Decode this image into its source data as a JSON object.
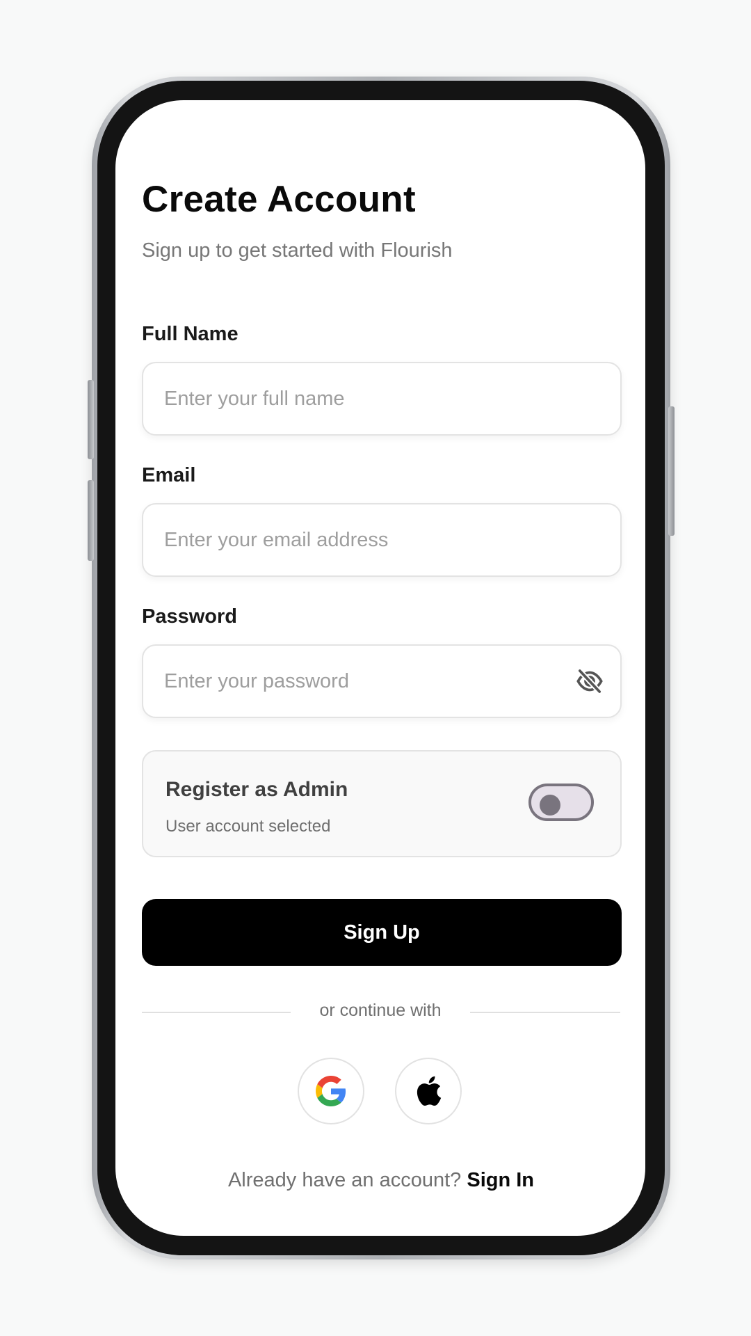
{
  "header": {
    "title": "Create Account",
    "subtitle": "Sign up to get started with Flourish"
  },
  "form": {
    "full_name": {
      "label": "Full Name",
      "placeholder": "Enter your full name",
      "value": ""
    },
    "email": {
      "label": "Email",
      "placeholder": "Enter your email address",
      "value": ""
    },
    "password": {
      "label": "Password",
      "placeholder": "Enter your password",
      "value": "",
      "visibility_icon": "eye-off-icon"
    }
  },
  "admin_toggle": {
    "title": "Register as Admin",
    "status": "User account selected",
    "enabled": false
  },
  "signup_button": {
    "label": "Sign Up"
  },
  "divider": {
    "text": "or continue with"
  },
  "social": [
    {
      "name": "google",
      "icon": "google-icon"
    },
    {
      "name": "apple",
      "icon": "apple-icon"
    }
  ],
  "footer": {
    "question": "Already have an account?",
    "link": "Sign In"
  },
  "colors": {
    "primary": "#000000",
    "background": "#ffffff",
    "muted_text": "#777777",
    "border": "#e3e3e3",
    "toggle_track": "#e6e0e9",
    "toggle_outline": "#79747e"
  }
}
